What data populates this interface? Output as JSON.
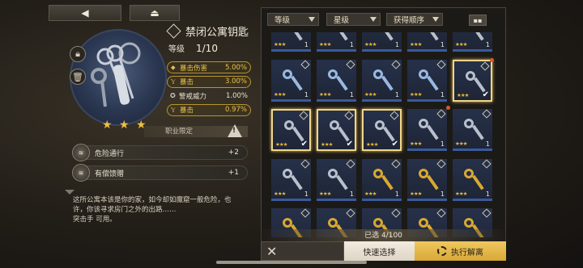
{
  "nav": {
    "back_icon": "◀",
    "home_icon": "⏏"
  },
  "item": {
    "title": "禁闭公寓钥匙",
    "level_label": "等级",
    "level_value": "1/10",
    "lock_icon": "lock-icon",
    "trash_icon": "trash-icon",
    "stars": "★ ★ ★"
  },
  "stats": [
    {
      "name": "暴击伤害",
      "value": "5.00%",
      "highlight": true,
      "icon": "⬥"
    },
    {
      "name": "暴击",
      "value": "3.00%",
      "highlight": true,
      "icon": "𝕐"
    },
    {
      "name": "警戒威力",
      "value": "1.00%",
      "highlight": false,
      "icon": "✪"
    },
    {
      "name": "暴击",
      "value": "0.97%",
      "highlight": true,
      "icon": "𝕐"
    }
  ],
  "class_limit": {
    "label": "职业限定",
    "warn_icon": "!"
  },
  "skills": [
    {
      "name": "危险通行",
      "value": "+2"
    },
    {
      "name": "有偿馈赠",
      "value": "+1"
    }
  ],
  "description": {
    "line1": "这所公寓本该是你的家，如今却如魔窟一般危险，也",
    "line2": "许，你该寻求房门之外的出路……",
    "line3": "突击手 可用。"
  },
  "filters": {
    "level": "等级",
    "star": "星级",
    "order": "获得顺序",
    "grid_toggle": "▪▪"
  },
  "grid_rows": [
    [
      "silver",
      "silver",
      "silver",
      "silver",
      "silver"
    ],
    [
      "crystal",
      "crystal",
      "crystal",
      "crystal",
      "silver"
    ],
    [
      "silver",
      "silver",
      "silver",
      "silver",
      "silver"
    ],
    [
      "silver",
      "silver",
      "gold",
      "gold",
      "gold"
    ],
    [
      "gold",
      "gold",
      "gold",
      "gold",
      "gold"
    ]
  ],
  "grid_counts": "1",
  "grid_stars": "★★★",
  "selected_text": "已选 4/100",
  "buttons": {
    "close": "✕",
    "quick_select": "快速选择",
    "execute": "执行解离"
  },
  "colors": {
    "accent": "#e8c24a",
    "selected_border": "#f0d68a",
    "exec_bg": "#e0b448"
  }
}
